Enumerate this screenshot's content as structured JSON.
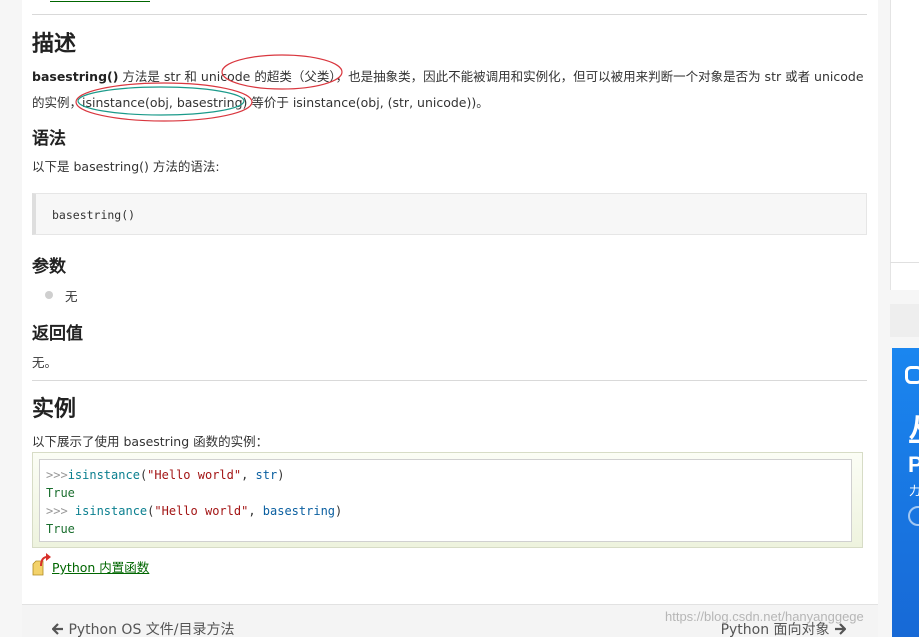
{
  "description": {
    "heading": "描述",
    "line1_bold": "basestring()",
    "line1_rest": " 方法是 str 和 unicode 的超类（父类），也是抽象类，因此不能被调用和实例化，但可以被用来判断一个对象是否为 str 或者 unicode",
    "line2": "的实例，isinstance(obj, basestring) 等价于 isinstance(obj, (str, unicode))。"
  },
  "syntax": {
    "heading": "语法",
    "intro": "以下是 basestring() 方法的语法:",
    "code": "basestring()"
  },
  "params": {
    "heading": "参数",
    "items": [
      "无"
    ]
  },
  "returns": {
    "heading": "返回值",
    "text": "无。"
  },
  "example": {
    "heading": "实例",
    "intro": "以下展示了使用 basestring 函数的实例：",
    "lines": [
      {
        "prompt": ">>>",
        "fn": "isinstance",
        "open": "(",
        "str": "\"Hello world\"",
        "sep": ", ",
        "arg": "str",
        "close": ")"
      },
      {
        "output": "True"
      },
      {
        "prompt": ">>> ",
        "fn": "isinstance",
        "open": "(",
        "str": "\"Hello world\"",
        "sep": ", ",
        "arg": "basestring",
        "close": ")"
      },
      {
        "output": "True"
      }
    ]
  },
  "back_link": "Python 内置函数",
  "nav": {
    "prev": "Python OS 文件/目录方法",
    "next": "Python 面向对象"
  },
  "watermark": "https://blog.csdn.net/hanyanggege",
  "colors": {
    "link": "#006600",
    "annotation_red": "#d9363e",
    "annotation_teal": "#1a9a8a",
    "ad_blue": "#1a86f0"
  }
}
